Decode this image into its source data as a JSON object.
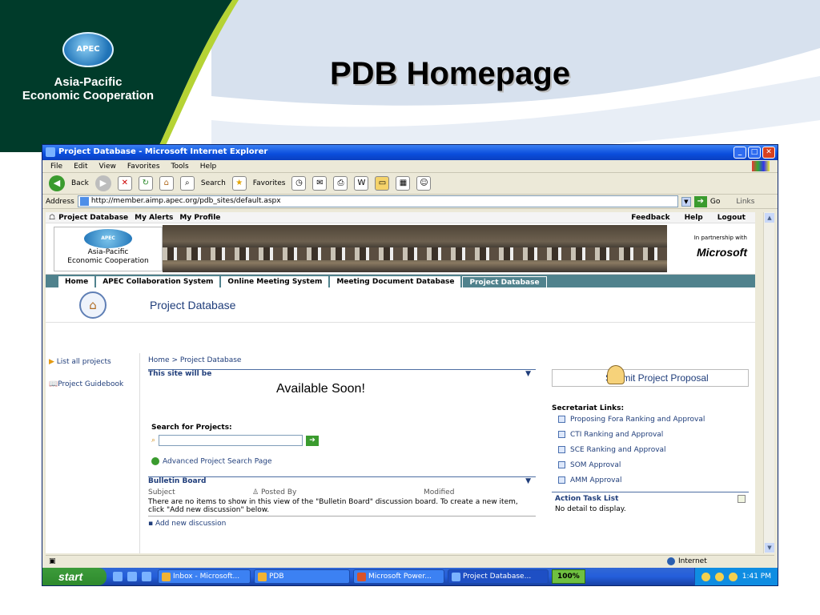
{
  "slide": {
    "title": "PDB Homepage",
    "logo_text": "APEC",
    "logo_name_line1": "Asia-Pacific",
    "logo_name_line2": "Economic Cooperation"
  },
  "browser": {
    "window_title": "Project Database - Microsoft Internet Explorer",
    "menu": [
      "File",
      "Edit",
      "View",
      "Favorites",
      "Tools",
      "Help"
    ],
    "toolbar": {
      "back": "Back",
      "search": "Search",
      "favorites": "Favorites"
    },
    "address_label": "Address",
    "address_value": "http://member.aimp.apec.org/pdb_sites/default.aspx",
    "go_label": "Go",
    "links_label": "Links"
  },
  "site": {
    "toplinks_left": [
      "Project Database",
      "My Alerts",
      "My Profile"
    ],
    "toplinks_right": [
      "Feedback",
      "Help",
      "Logout"
    ],
    "banner": {
      "logo_text": "APEC",
      "logo_line1": "Asia-Pacific",
      "logo_line2": "Economic Cooperation",
      "partner_text": "In partnership with",
      "partner_name": "Microsoft"
    },
    "nav_tabs": [
      "Home",
      "APEC Collaboration System",
      "Online Meeting System",
      "Meeting Document Database",
      "Project Database"
    ],
    "page_title": "Project Database",
    "left_nav": [
      "List all projects",
      "Project Guidebook"
    ],
    "breadcrumb": "Home > Project Database",
    "site_will_be_header": "This site will be",
    "available_soon": "Available Soon!",
    "search_label": "Search for Projects:",
    "search_value": "",
    "advanced_search": "Advanced Project Search Page",
    "bulletin": {
      "header": "Bulletin Board",
      "columns": [
        "Subject",
        "Posted By",
        "Modified"
      ],
      "empty_text": "There are no items to show in this view of the \"Bulletin Board\" discussion board. To create a new item, click \"Add new discussion\" below.",
      "add_link": "Add new discussion"
    },
    "submit_proposal": "Submit Project Proposal",
    "secretariat_title": "Secretariat Links:",
    "secretariat_links": [
      "Proposing Fora Ranking and Approval",
      "CTI Ranking and Approval",
      "SCE Ranking and Approval",
      "SOM Approval",
      "AMM Approval"
    ],
    "action_task_header": "Action Task List",
    "no_detail": "No detail to display."
  },
  "statusbar": {
    "zone": "Internet"
  },
  "taskbar": {
    "start": "start",
    "tasks": [
      "Inbox - Microsoft...",
      "PDB",
      "Microsoft Power...",
      "Project Database..."
    ],
    "zoom": "100%",
    "clock": "1:41 PM"
  },
  "colors": {
    "brand_green": "#003b2a",
    "nav_teal": "#50828d",
    "link_blue": "#1f3d7a",
    "xp_blue": "#245edb"
  }
}
